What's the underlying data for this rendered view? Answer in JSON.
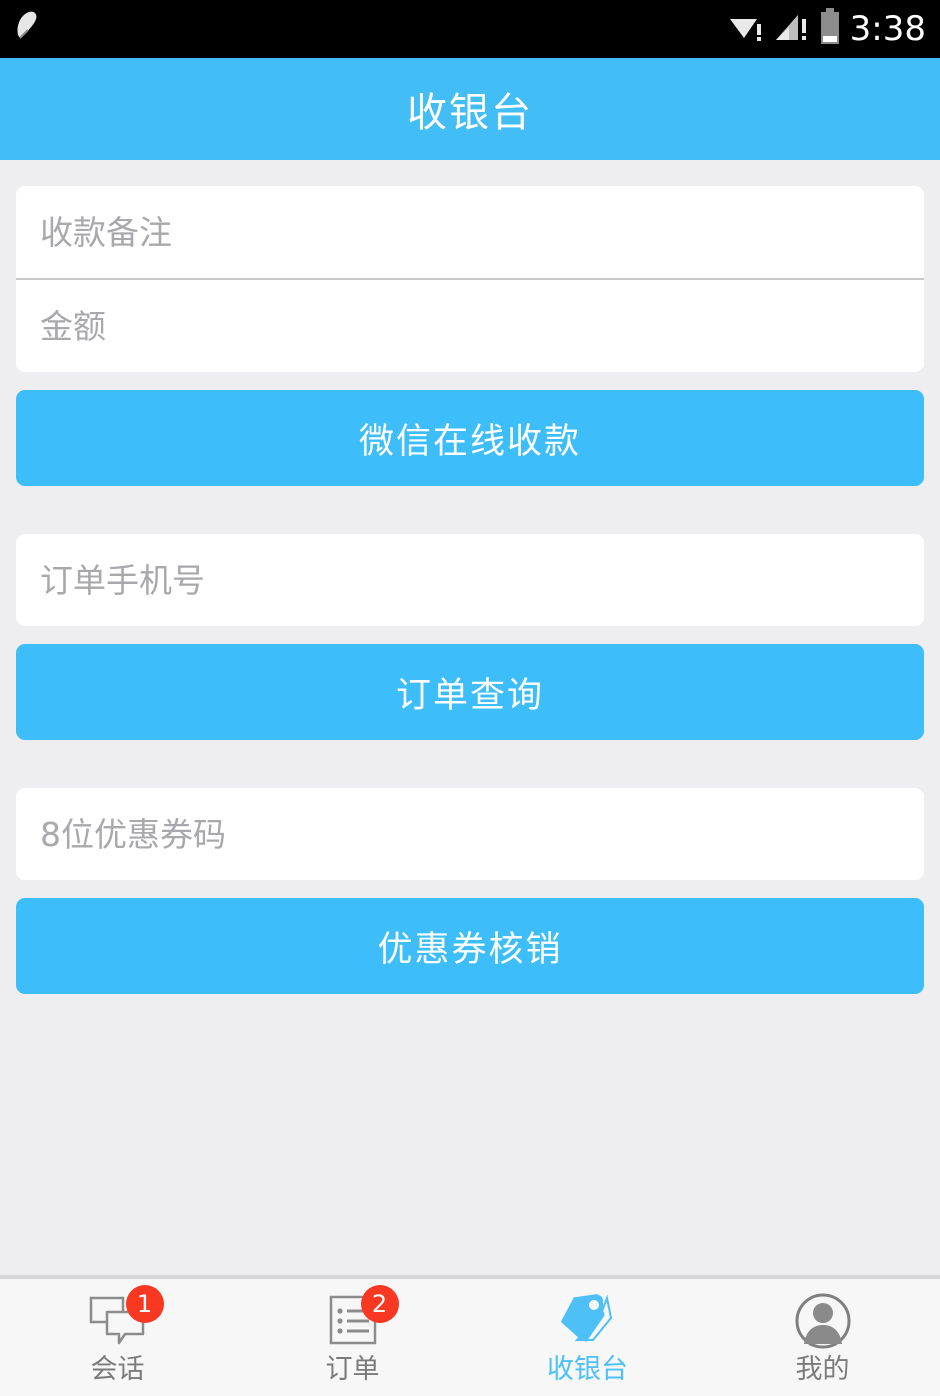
{
  "status_bar": {
    "time": "3:38",
    "icons": [
      "notification-icon",
      "wifi-icon",
      "cellular-signal-icon",
      "battery-icon"
    ],
    "background_color": "#000000"
  },
  "header": {
    "title": "收银台",
    "background_color": "#42bdf5",
    "text_color": "#ffffff"
  },
  "theme": {
    "accent": "#3dbefb",
    "page_background": "#eeeef1",
    "card_background": "#ffffff",
    "placeholder_color": "#a9a9ad",
    "badge_color": "#f93822"
  },
  "main": {
    "payment_section": {
      "remark_input": {
        "placeholder": "收款备注",
        "value": ""
      },
      "amount_input": {
        "placeholder": "金额",
        "value": ""
      },
      "submit_button": "微信在线收款"
    },
    "order_section": {
      "phone_input": {
        "placeholder": "订单手机号",
        "value": ""
      },
      "submit_button": "订单查询"
    },
    "coupon_section": {
      "code_input": {
        "placeholder": "8位优惠券码",
        "value": ""
      },
      "submit_button": "优惠券核销"
    }
  },
  "bottom_nav": {
    "items": [
      {
        "label": "会话",
        "icon": "chat-bubbles-icon",
        "badge": "1",
        "active": false
      },
      {
        "label": "订单",
        "icon": "order-list-icon",
        "badge": "2",
        "active": false
      },
      {
        "label": "收银台",
        "icon": "price-tag-icon",
        "badge": "",
        "active": true
      },
      {
        "label": "我的",
        "icon": "user-avatar-icon",
        "badge": "",
        "active": false
      }
    ]
  }
}
